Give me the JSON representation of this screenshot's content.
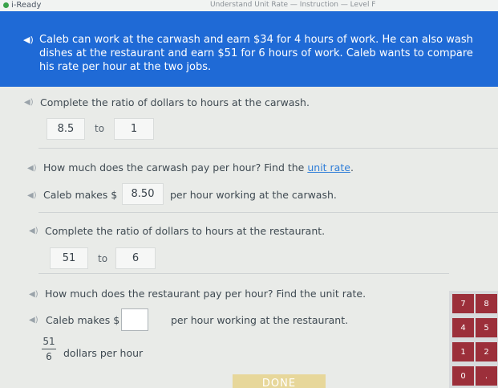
{
  "app": {
    "name": "i-Ready",
    "breadcrumb": "Understand Unit Rate — Instruction — Level F"
  },
  "banner": {
    "text": "Caleb can work at the carwash and earn $34 for 4 hours of work. He can also wash dishes at the restaurant and earn $51 for 6 hours of work. Caleb wants to compare his rate per hour at the two jobs."
  },
  "steps": {
    "carwash_ratio_prompt": "Complete the ratio of dollars to hours at the carwash.",
    "carwash_ratio": {
      "dollars": "8.5",
      "to": "to",
      "hours": "1"
    },
    "carwash_rate_question_pre": "How much does the carwash pay per hour? Find the ",
    "carwash_rate_question_link": "unit rate",
    "carwash_rate_question_post": ".",
    "carwash_answer_prefix": "Caleb makes $",
    "carwash_answer_value": "8.50",
    "carwash_answer_suffix": "per hour working at the carwash.",
    "restaurant_ratio_prompt": "Complete the ratio of dollars to hours at the restaurant.",
    "restaurant_ratio": {
      "dollars": "51",
      "to": "to",
      "hours": "6"
    },
    "restaurant_rate_question": "How much does the restaurant pay per hour? Find the unit rate.",
    "restaurant_answer_prefix": "Caleb makes $",
    "restaurant_answer_suffix": "per hour working at the restaurant.",
    "fraction": {
      "numerator": "51",
      "denominator": "6",
      "label": "dollars per hour"
    }
  },
  "keypad": {
    "keys": [
      "7",
      "8",
      "4",
      "5",
      "1",
      "2",
      "0",
      "."
    ]
  },
  "done_button": "DONE",
  "colors": {
    "banner_blue": "#1f6ad6",
    "keypad_red": "#9c2f3a",
    "done_disabled": "#e7d79a",
    "link_blue": "#2f7ed8"
  }
}
